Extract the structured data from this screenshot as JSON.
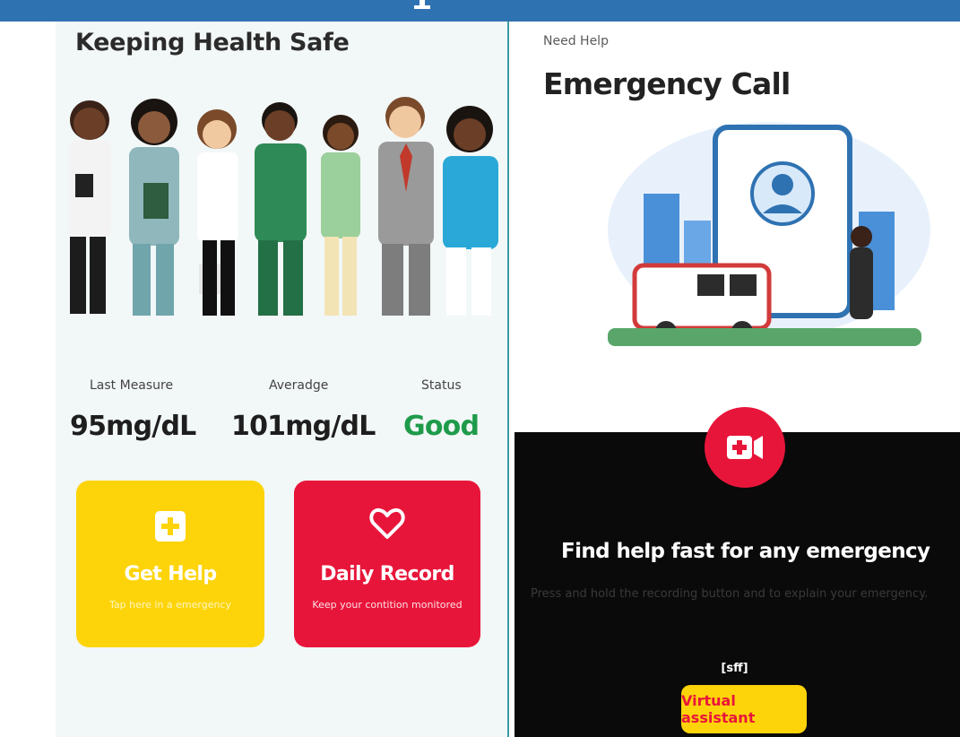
{
  "left": {
    "title": "Keeping Health Safe",
    "stats": [
      {
        "label": "Last Measure",
        "value": "95mg/dL"
      },
      {
        "label": "Averadge",
        "value": "101mg/dL"
      },
      {
        "label": "Status",
        "value": "Good"
      }
    ],
    "cards": {
      "get_help": {
        "title": "Get Help",
        "subtitle": "Tap here in a emergency",
        "icon": "plus-icon"
      },
      "daily_record": {
        "title": "Daily Record",
        "subtitle": "Keep your contition monitored",
        "icon": "heart-icon"
      }
    }
  },
  "right": {
    "overline": "Need Help",
    "title": "Emergency Call",
    "record_button_icon": "video-plus-icon",
    "headline": "Find help fast for any emergency",
    "description": "Press and hold the recording button and to explain your emergency.",
    "bracket_text": "[sff]",
    "assistant_label": "Virtual assistant"
  },
  "colors": {
    "topbar": "#2f72b2",
    "accent_yellow": "#fdd40a",
    "accent_red": "#e8153a",
    "status_green": "#1e9b4a",
    "panel_bg": "#f2f7f7"
  }
}
